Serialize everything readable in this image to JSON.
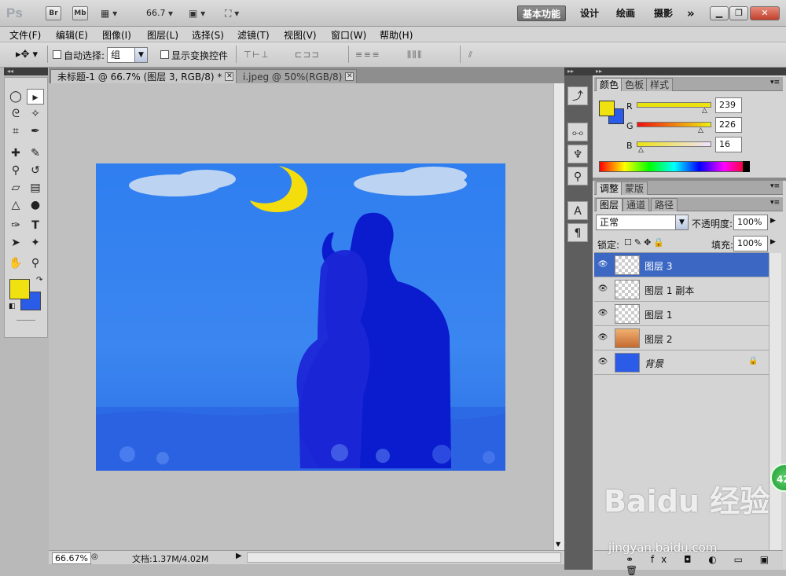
{
  "app": {
    "logo": "Ps",
    "bridge_label": "Br",
    "minibridge_label": "Mb",
    "zoom": "66.7",
    "workspaces": [
      "基本功能",
      "设计",
      "绘画",
      "摄影"
    ],
    "more": "»"
  },
  "menu": [
    "文件(F)",
    "编辑(E)",
    "图像(I)",
    "图层(L)",
    "选择(S)",
    "滤镜(T)",
    "视图(V)",
    "窗口(W)",
    "帮助(H)"
  ],
  "options": {
    "auto_select_label": "自动选择:",
    "auto_select_value": "组",
    "show_transform_label": "显示变换控件"
  },
  "tabs": [
    {
      "label": "未标题-1 @ 66.7% (图层 3, RGB/8) *"
    },
    {
      "label": "i.jpeg @ 50%(RGB/8)"
    }
  ],
  "status": {
    "zoom": "66.67%",
    "doc_size": "文档:1.37M/4.02M"
  },
  "color_panel": {
    "tabs": [
      "颜色",
      "色板",
      "样式"
    ],
    "r_label": "R",
    "g_label": "G",
    "b_label": "B",
    "r": "239",
    "g": "226",
    "b": "16",
    "fg_color": "#efe210",
    "bg_color": "#2a5ce8"
  },
  "adjust_panel": {
    "tabs": [
      "调整",
      "蒙版"
    ]
  },
  "layers_panel": {
    "tabs": [
      "图层",
      "通道",
      "路径"
    ],
    "blend_mode": "正常",
    "opacity_label": "不透明度:",
    "opacity": "100%",
    "lock_label": "锁定:",
    "fill_label": "填充:",
    "fill": "100%",
    "layers": [
      {
        "name": "图层 3",
        "selected": true
      },
      {
        "name": "图层 1 副本",
        "selected": false
      },
      {
        "name": "图层 1",
        "selected": false
      },
      {
        "name": "图层 2",
        "selected": false
      },
      {
        "name": "背景",
        "selected": false
      }
    ]
  },
  "badge": "42",
  "watermark": {
    "line1": "Baidu 经验",
    "line2": "jingyan.baidu.com"
  }
}
